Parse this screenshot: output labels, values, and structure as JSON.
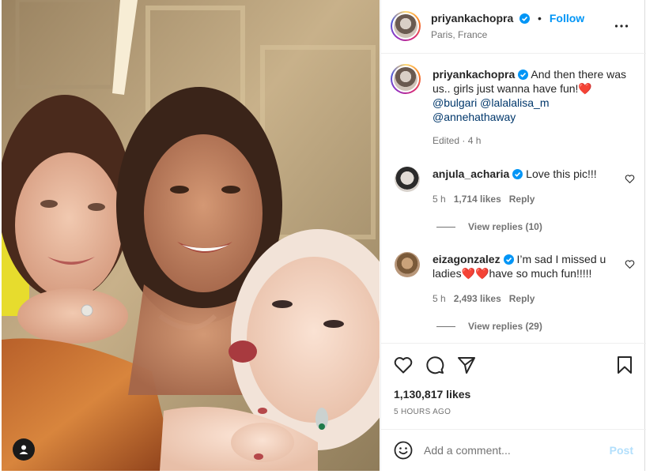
{
  "post": {
    "username": "priyankachopra",
    "follow_label": "Follow",
    "separator": "•",
    "location": "Paris, France",
    "more_icon": "more-horizontal-icon",
    "verified_color": "#0095f6"
  },
  "caption": {
    "username": "priyankachopra",
    "text": "And then there was us.. girls just wanna have fun!❤️",
    "mentions": [
      "@bulgari",
      "@lalalalisa_m",
      "@annehathaway"
    ],
    "edited": "Edited",
    "time": "4 h"
  },
  "comments": [
    {
      "username": "anjula_acharia",
      "text": "Love this pic!!!",
      "time": "5 h",
      "likes": "1,714 likes",
      "reply_label": "Reply",
      "view_replies": "View replies (10)"
    },
    {
      "username": "eizagonzalez",
      "text": "I’m sad I missed u ladies❤️❤️have so much fun!!!!!",
      "time": "5 h",
      "likes": "2,493 likes",
      "reply_label": "Reply",
      "view_replies": "View replies (29)"
    }
  ],
  "actions": {
    "icons": [
      "heart-icon",
      "comment-icon",
      "share-icon",
      "bookmark-icon"
    ],
    "likes": "1,130,817 likes",
    "time_ago": "5 HOURS AGO"
  },
  "add_comment": {
    "placeholder": "Add a comment...",
    "post_label": "Post"
  },
  "colors": {
    "accent": "#0095f6",
    "mention": "#00376b",
    "muted": "#737373",
    "heart": "#ed4956"
  }
}
